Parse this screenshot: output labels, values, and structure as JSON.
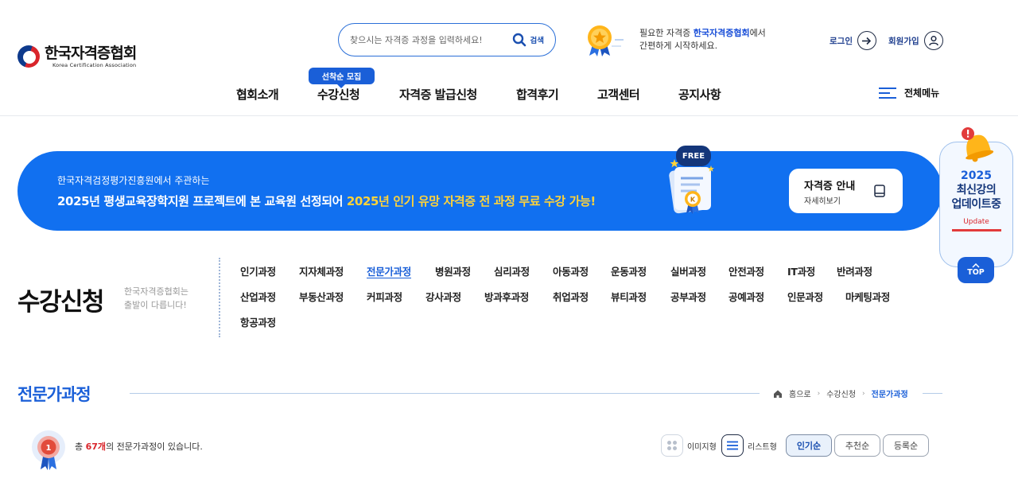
{
  "header": {
    "logo": {
      "name_ko": "한국자격증협회",
      "name_en": "Korea Certification Association"
    },
    "search": {
      "placeholder": "찾으시는 자격증 과정을 입력하세요!",
      "button_label": "검색"
    },
    "notice": {
      "prefix": "필요한 자격증 ",
      "highlight": "한국자격증협회",
      "suffix": "에서",
      "line2": "간편하게 시작하세요."
    },
    "login_label": "로그인",
    "signup_label": "회원가입",
    "recruit_badge": "선착순 모집",
    "nav": [
      "협회소개",
      "수강신청",
      "자격증 발급신청",
      "합격후기",
      "고객센터",
      "공지사항"
    ],
    "all_menu_label": "전체메뉴"
  },
  "banner": {
    "sub": "한국자격검정평가진흥원에서 주관하는",
    "main_prefix": "2025년 평생교육장학지원 프로젝트에 본 교육원 선정되어 ",
    "main_highlight": "2025년 인기 유망 자격증 전 과정 무료 수강 가능!",
    "free_badge": "FREE",
    "cert_button": {
      "title": "자격증 안내",
      "sub": "자세히보기"
    }
  },
  "float_update": {
    "year": "2025",
    "line2": "최신강의",
    "line3": "업데이트중",
    "update_label": "Update",
    "top_label": "TOP"
  },
  "category": {
    "title": "수강신청",
    "sub_line1": "한국자격증협회는",
    "sub_line2": "출발이 다릅니다!",
    "items": [
      "인기과정",
      "지자체과정",
      "전문가과정",
      "병원과정",
      "심리과정",
      "아동과정",
      "운동과정",
      "실버과정",
      "안전과정",
      "IT과정",
      "반려과정",
      "산업과정",
      "부동산과정",
      "커피과정",
      "강사과정",
      "방과후과정",
      "취업과정",
      "뷰티과정",
      "공부과정",
      "공예과정",
      "인문과정",
      "마케팅과정",
      "항공과정"
    ],
    "active": "전문가과정"
  },
  "section": {
    "title": "전문가과정",
    "breadcrumb": [
      "홈으로",
      "수강신청",
      "전문가과정"
    ]
  },
  "listing": {
    "count_prefix": "총 ",
    "count_value": "67개",
    "count_suffix": "의 전문가과정이 있습니다.",
    "badge_number": "1",
    "view_image_label": "이미지형",
    "view_list_label": "리스트형",
    "sort": [
      "인기순",
      "추천순",
      "등록순"
    ]
  },
  "colors": {
    "primary": "#1a5fd8",
    "banner": "#1170f0",
    "highlight_yellow": "#ffd33a",
    "accent_red": "#d9252b"
  }
}
